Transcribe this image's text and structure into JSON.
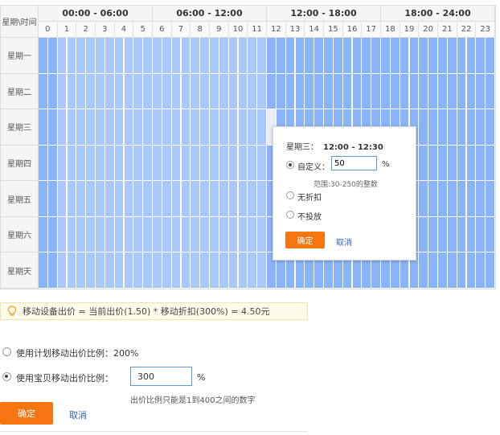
{
  "schedule": {
    "corner_label": "星期\\时间",
    "periods": [
      "00:00 - 06:00",
      "06:00 - 12:00",
      "12:00 - 18:00",
      "18:00 - 24:00"
    ],
    "hours": [
      "0",
      "1",
      "2",
      "3",
      "4",
      "5",
      "6",
      "7",
      "8",
      "9",
      "10",
      "11",
      "12",
      "13",
      "14",
      "15",
      "16",
      "17",
      "18",
      "19",
      "20",
      "21",
      "22",
      "23"
    ],
    "days": [
      "星期一",
      "星期二",
      "星期三",
      "星期四",
      "星期五",
      "星期六",
      "星期天"
    ]
  },
  "popup": {
    "day": "星期三：",
    "time_range": "12:00 - 12:30",
    "custom_label": "自定义：",
    "custom_value": "50",
    "percent": "%",
    "range_hint": "范围:30-250的整数",
    "no_discount_label": "无折扣",
    "no_bid_label": "不投放",
    "confirm_label": "确定",
    "cancel_label": "取消"
  },
  "info_bar": {
    "text": "移动设备出价 = 当前出价(1.50) * 移动折扣(300%) = 4.50元"
  },
  "options": {
    "plan_ratio_label": "使用计划移动出价比例：200%",
    "item_ratio_label": "使用宝贝移动出价比例：",
    "item_ratio_value": "300",
    "percent": "%",
    "hint": "出价比例只能是1到400之间的数字"
  },
  "footer": {
    "confirm_label": "确定",
    "cancel_label": "取消"
  },
  "colors": {
    "cell_blue": "#8ab4f8",
    "cell_light": "#a9c8fb",
    "accent_orange": "#f7750f",
    "link_blue": "#2d66c4"
  }
}
